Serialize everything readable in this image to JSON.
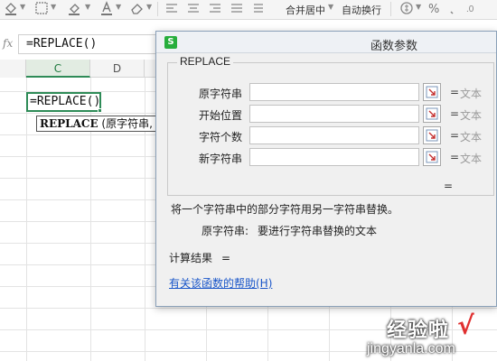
{
  "toolbar": {
    "align_merge_label": "合并居中",
    "wrap_text_label": "自动换行",
    "percent_label": "%",
    "icons": [
      "paint-bucket-icon",
      "font-color-icon",
      "eraser-icon",
      "align-left-icon",
      "align-center-icon",
      "align-right-icon",
      "currency-icon",
      "percent-icon"
    ]
  },
  "formula_bar": {
    "fx_label": "fx",
    "formula": "=REPLACE()"
  },
  "grid": {
    "columns": [
      {
        "label": "C",
        "selected": true
      },
      {
        "label": "D",
        "selected": false
      }
    ],
    "active_cell_value": "=REPLACE()",
    "tooltip": {
      "func_name": "REPLACE",
      "args": " (原字符串, 开"
    }
  },
  "dialog": {
    "logo_letter": "S",
    "title": "函数参数",
    "function_name": "REPLACE",
    "params": [
      {
        "label": "原字符串",
        "value": "",
        "eq": "=",
        "type": "文本"
      },
      {
        "label": "开始位置",
        "value": "",
        "eq": "=",
        "type": "文本"
      },
      {
        "label": "字符个数",
        "value": "",
        "eq": "=",
        "type": "文本"
      },
      {
        "label": "新字符串",
        "value": "",
        "eq": "=",
        "type": "文本"
      }
    ],
    "result_eq": "=",
    "description": "将一个字符串中的部分字符用另一字符串替换。",
    "param_desc_name": "原字符串:",
    "param_desc_text": "要进行字符串替换的文本",
    "calc_result_label": "计算结果",
    "calc_result_eq": "=",
    "help_link": "有关该函数的帮助(H)"
  },
  "watermark": {
    "logo_text": "经验啦",
    "check": "√",
    "url": "jingyanla.com"
  },
  "colors": {
    "accent_green": "#2e8b57",
    "link_blue": "#1a56c9",
    "logo_green": "#27ae3c",
    "watermark_red": "#e03030"
  }
}
